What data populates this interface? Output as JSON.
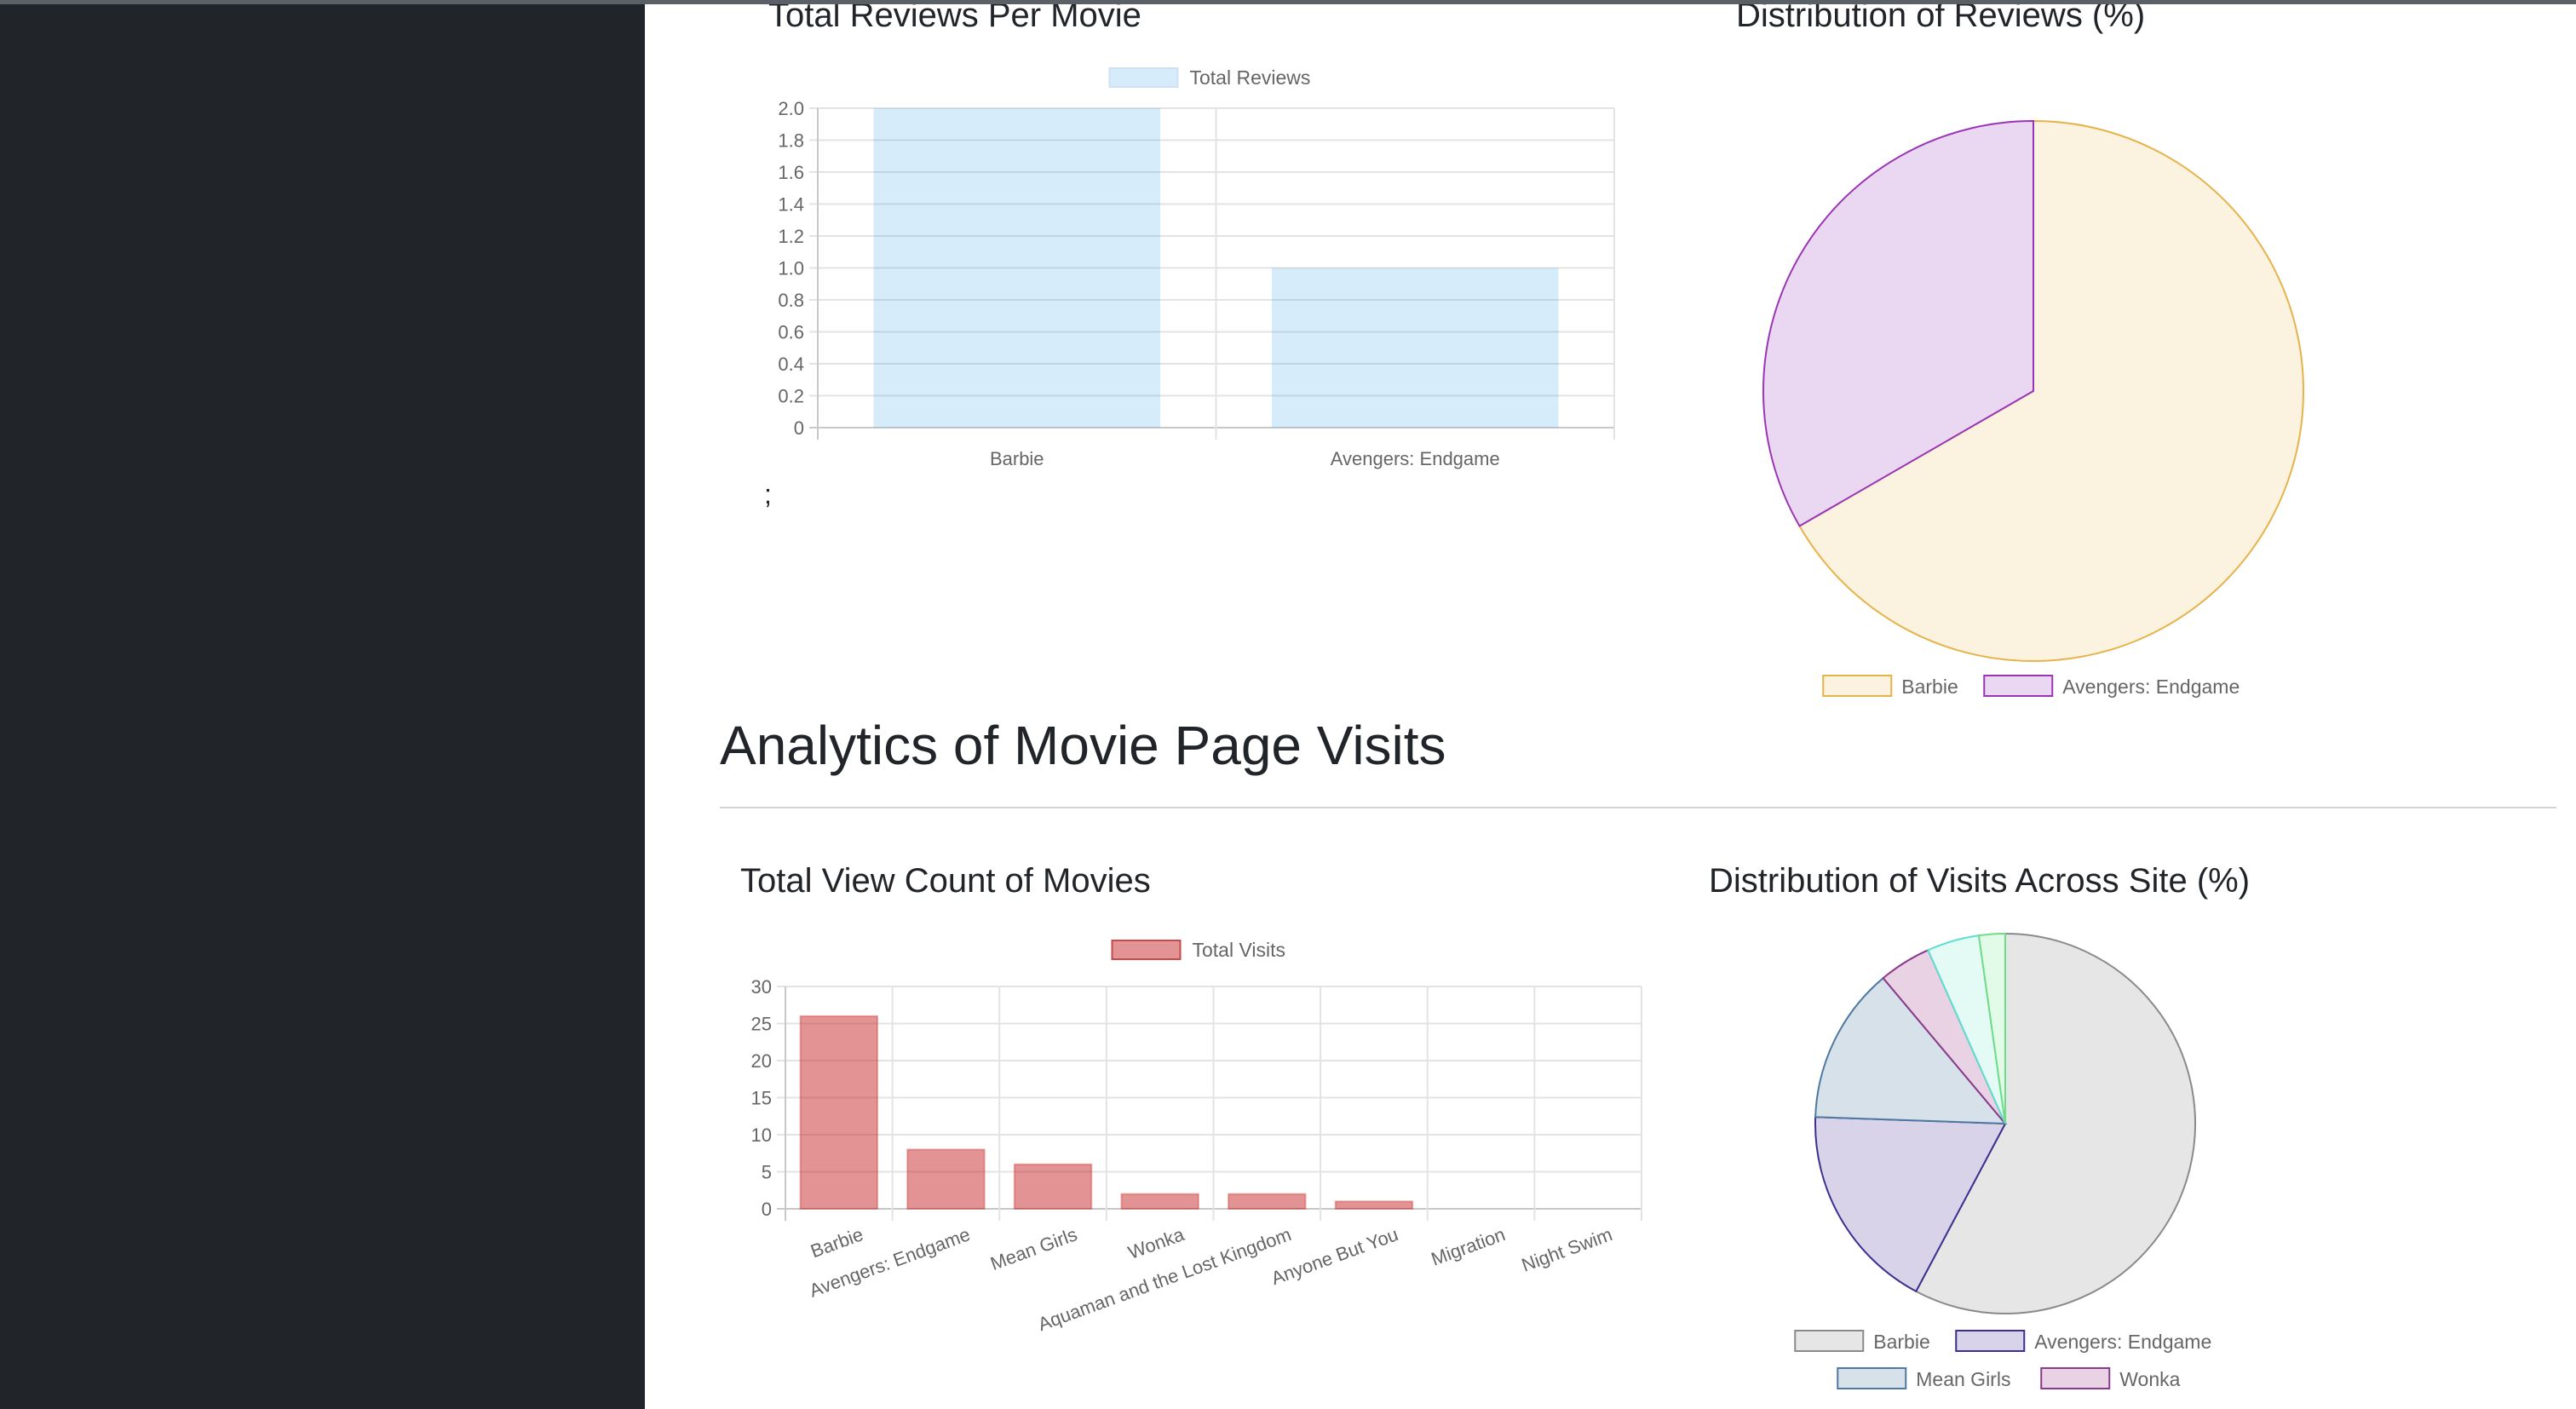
{
  "theme": {
    "sidebar_bg": "#212529",
    "top_border": "#5b6066",
    "content_bg": "#ffffff"
  },
  "reviews_section": {
    "bar_card": {
      "title": "Total Reviews Per Movie",
      "stray_text": ";",
      "chart_data": {
        "type": "bar",
        "categories": [
          "Barbie",
          "Avengers: Endgame"
        ],
        "series": [
          {
            "name": "Total Reviews",
            "values": [
              2,
              1
            ],
            "color": "rgba(54,162,235,0.2)"
          }
        ],
        "yticks": [
          "0",
          "0.2",
          "0.4",
          "0.6",
          "0.8",
          "1.0",
          "1.2",
          "1.4",
          "1.6",
          "1.8",
          "2.0"
        ],
        "ylim": [
          0,
          2
        ],
        "grid": true,
        "legend": "top"
      }
    },
    "pie_card": {
      "title": "Distribution of Reviews (%)",
      "chart_data": {
        "type": "pie",
        "labels": [
          "Barbie",
          "Avengers: Endgame"
        ],
        "values": [
          2,
          1
        ],
        "fill_colors": [
          "#fbf2df",
          "#ead8f2"
        ],
        "border_colors": [
          "#e6b34a",
          "#9b35b5"
        ],
        "legend": "bottom"
      }
    }
  },
  "visits_section": {
    "heading": "Analytics of Movie Page Visits",
    "bar_card": {
      "title": "Total View Count of Movies",
      "chart_data": {
        "type": "bar",
        "categories": [
          "Barbie",
          "Avengers: Endgame",
          "Mean Girls",
          "Wonka",
          "Aquaman and the Lost Kingdom",
          "Anyone But You",
          "Migration",
          "Night Swim"
        ],
        "series": [
          {
            "name": "Total Visits",
            "values": [
              26,
              8,
              6,
              2,
              2,
              1,
              0,
              0
            ],
            "color": "rgba(200,40,40,0.5)"
          }
        ],
        "yticks": [
          "0",
          "5",
          "10",
          "15",
          "20",
          "25",
          "30"
        ],
        "ylim": [
          0,
          30
        ],
        "grid": true,
        "legend": "top"
      }
    },
    "pie_card": {
      "title": "Distribution of Visits Across Site (%)",
      "chart_data": {
        "type": "pie",
        "labels": [
          "Barbie",
          "Avengers: Endgame",
          "Mean Girls",
          "Wonka",
          "Aquaman and the Lost Kingdom",
          "Anyone But You",
          "Migration",
          "Night Swim"
        ],
        "values": [
          26,
          8,
          6,
          2,
          2,
          1,
          0,
          0
        ],
        "fill_colors": [
          "#e6e6e6",
          "#d8d3e8",
          "#d6e1ea",
          "#e8d2e4",
          "#e3faf5",
          "#e2fbe8",
          "#e8e8e8",
          "#e8e8e8"
        ],
        "border_colors": [
          "#8a8a8a",
          "#3b2f8f",
          "#4f79a0",
          "#8b3a8b",
          "#5ee0d0",
          "#6fdc86",
          "#888888",
          "#888888"
        ],
        "visible_legend_labels": [
          "Barbie",
          "Avengers: Endgame",
          "Mean Girls",
          "Wonka"
        ],
        "legend": "bottom"
      }
    }
  }
}
